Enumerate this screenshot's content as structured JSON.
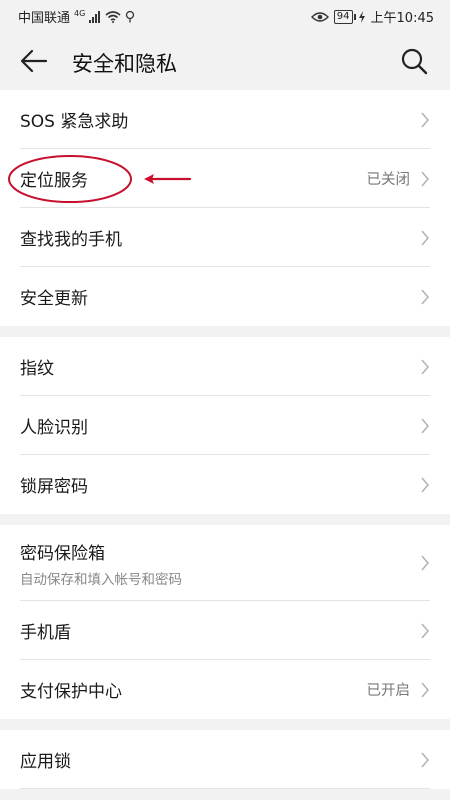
{
  "status_bar": {
    "carrier": "中国联通",
    "network": "4G",
    "battery": "94",
    "time": "上午10:45"
  },
  "header": {
    "title": "安全和隐私"
  },
  "groups": [
    {
      "items": [
        {
          "label": "SOS 紧急求助"
        },
        {
          "label": "定位服务",
          "value": "已关闭"
        },
        {
          "label": "查找我的手机"
        },
        {
          "label": "安全更新"
        }
      ]
    },
    {
      "items": [
        {
          "label": "指纹"
        },
        {
          "label": "人脸识别"
        },
        {
          "label": "锁屏密码"
        }
      ]
    },
    {
      "items": [
        {
          "label": "密码保险箱",
          "sub": "自动保存和填入帐号和密码"
        },
        {
          "label": "手机盾"
        },
        {
          "label": "支付保护中心",
          "value": "已开启"
        }
      ]
    },
    {
      "items": [
        {
          "label": "应用锁"
        }
      ]
    }
  ],
  "colors": {
    "annotation": "#c8102e",
    "background": "#f2f2f2",
    "card": "#ffffff"
  }
}
